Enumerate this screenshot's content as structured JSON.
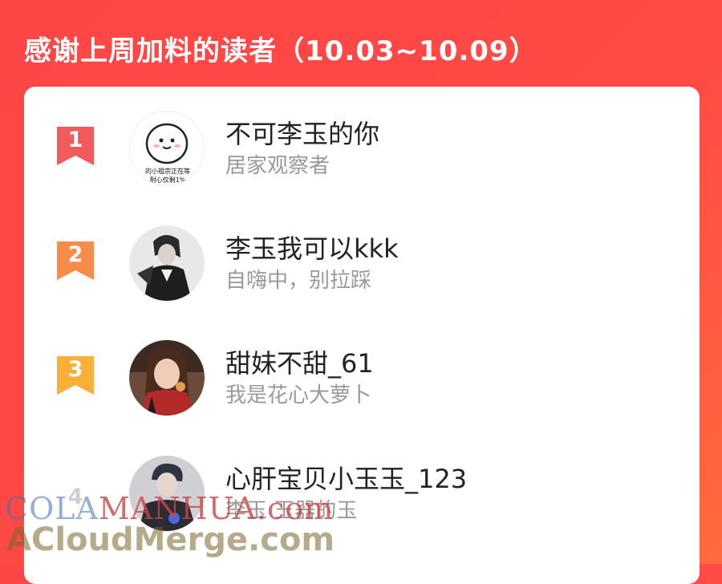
{
  "header": {
    "title": "感谢上周加料的读者（10.03~10.09）"
  },
  "colors": {
    "background": "#ff4646",
    "rank_1": "#f25a5c",
    "rank_2": "#f78b4a",
    "rank_3": "#fbae38",
    "rank_4": "#d0d0d0"
  },
  "readers": [
    {
      "rank": "1",
      "name": "不可李玉的你",
      "subtitle": "居家观察者",
      "avatar_caption_1": "的小祖宗正在等",
      "avatar_caption_2": "耐心仅剩1%"
    },
    {
      "rank": "2",
      "name": "李玉我可以kkk",
      "subtitle": "自嗨中，别拉踩"
    },
    {
      "rank": "3",
      "name": "甜妹不甜_61",
      "subtitle": "我是花心大萝卜"
    },
    {
      "rank": "4",
      "name": "心肝宝贝小玉玉_123",
      "subtitle": "李玉 玉器的玉"
    }
  ],
  "watermark": {
    "line1_a": "COLA",
    "line1_b": "MANHUA.com",
    "line2": "ACloudMerge.com"
  }
}
